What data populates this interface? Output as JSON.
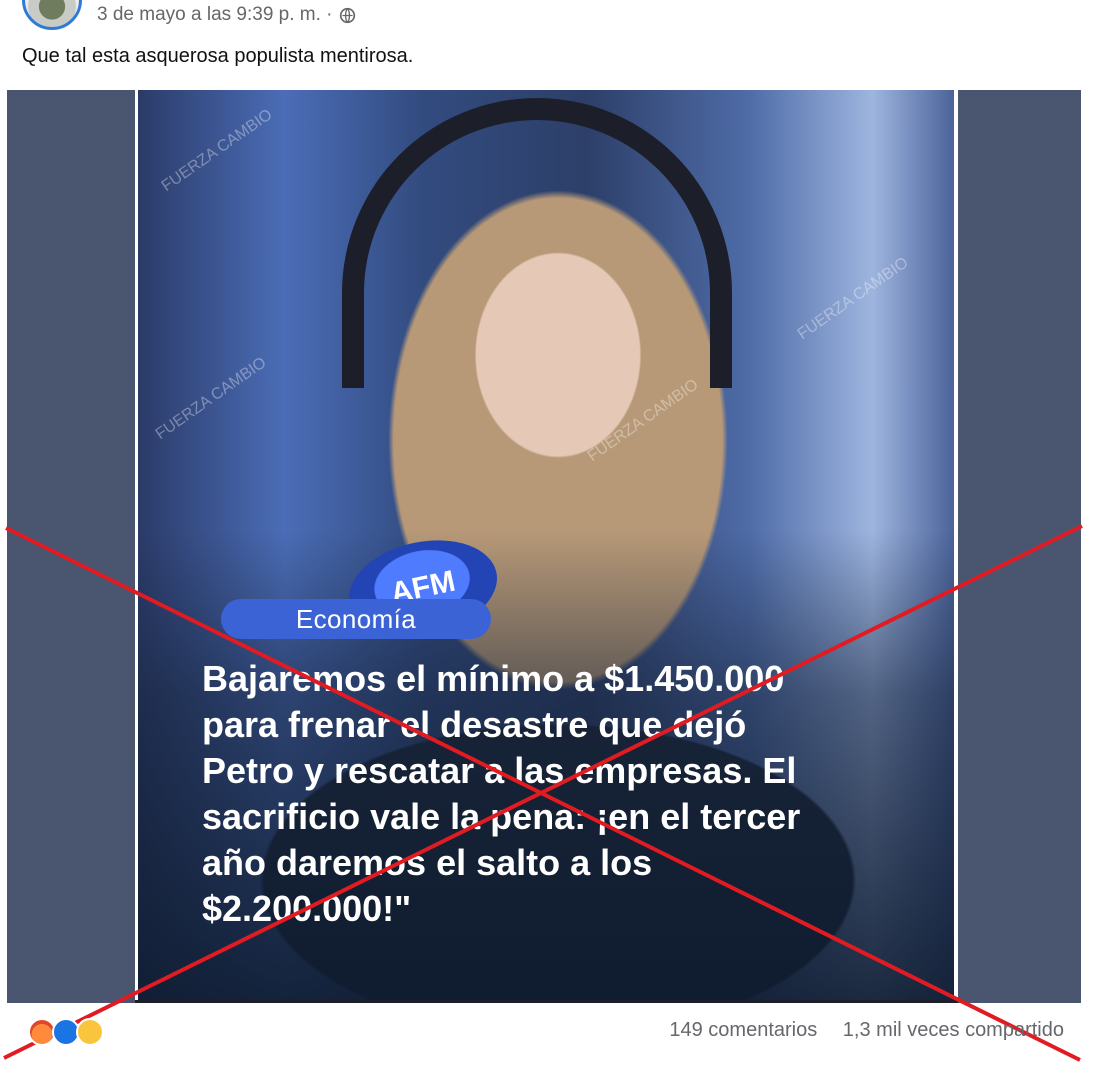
{
  "post": {
    "timestamp": "3 de mayo a las 9:39 p. m. ·",
    "text": "Que tal esta asquerosa populista mentirosa."
  },
  "image": {
    "category": "Economía",
    "quote": "Bajaremos el mínimo a $1.450.000\npara frenar el desastre que dejó\nPetro y rescatar a las empresas. El\nsacrificio vale la pena: ¡en el tercer\naño daremos el salto a los\n$2.200.000!\"",
    "watermark": "FUERZA CAMBIO",
    "mic_logo": "AFM"
  },
  "stats": {
    "comments": "149 comentarios",
    "shares": "1,3 mil veces compartido"
  },
  "colors": {
    "overlay_cross": "#e11b22",
    "media_background": "#4a5670",
    "meta_text": "#65676b"
  },
  "icons": {
    "privacy": "globe-icon",
    "reactions": [
      "angry-reaction-icon",
      "like-reaction-icon",
      "haha-reaction-icon"
    ]
  }
}
